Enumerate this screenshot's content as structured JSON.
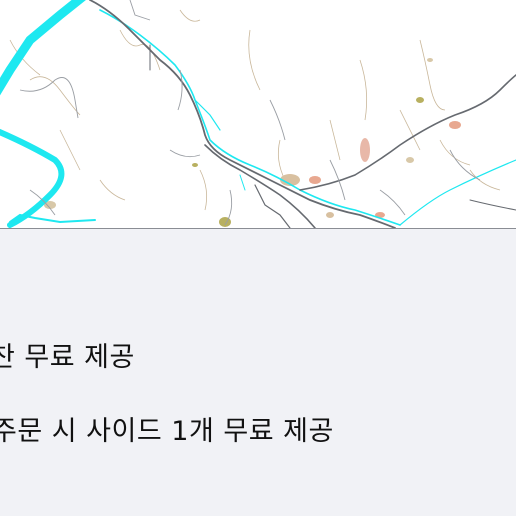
{
  "map": {
    "colors": {
      "river": "#1ee8f0",
      "road": "#666a70",
      "road_light": "#9a9ea4",
      "terrain": "#d8c8a8",
      "settlement": "#e8a890",
      "vegetation": "#b8b060"
    }
  },
  "promotions": {
    "line_1": "찬 무료 제공",
    "line_2": "주문 시 사이드 1개 무료 제공"
  }
}
